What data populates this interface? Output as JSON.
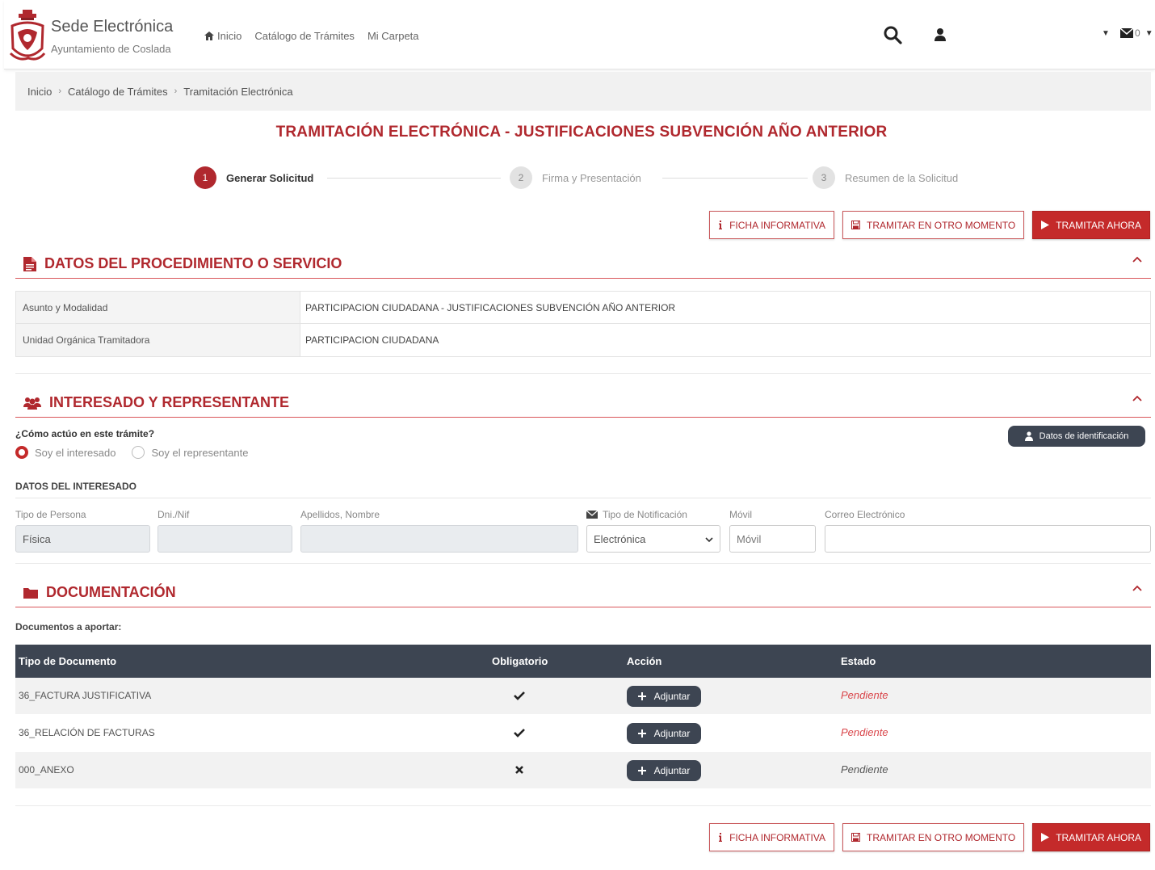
{
  "header": {
    "brand_title": "Sede Electrónica",
    "brand_subtitle": "Ayuntamiento de Coslada",
    "nav": [
      "Inicio",
      "Catálogo de Trámites",
      "Mi Carpeta"
    ],
    "mail_count": "0"
  },
  "breadcrumb": [
    "Inicio",
    "Catálogo de Trámites",
    "Tramitación Electrónica"
  ],
  "page_title": "TRAMITACIÓN ELECTRÓNICA - JUSTIFICACIONES SUBVENCIÓN AÑO ANTERIOR",
  "steps": [
    {
      "num": "1",
      "label": "Generar Solicitud"
    },
    {
      "num": "2",
      "label": "Firma y Presentación"
    },
    {
      "num": "3",
      "label": "Resumen de la Solicitud"
    }
  ],
  "actions": {
    "ficha": "FICHA INFORMATIVA",
    "otro_momento": "TRAMITAR EN OTRO MOMENTO",
    "ahora": "TRAMITAR AHORA"
  },
  "section_datos": {
    "title": "DATOS DEL PROCEDIMIENTO O SERVICIO",
    "rows": [
      {
        "key": "Asunto y Modalidad",
        "value": "PARTICIPACION CIUDADANA - JUSTIFICACIONES SUBVENCIÓN AÑO ANTERIOR"
      },
      {
        "key": "Unidad Orgánica Tramitadora",
        "value": "PARTICIPACION CIUDADANA"
      }
    ]
  },
  "section_interesado": {
    "title": "INTERESADO Y REPRESENTANTE",
    "question": "¿Cómo actúo en este trámite?",
    "radio_interesado": "Soy el interesado",
    "radio_representante": "Soy el representante",
    "ident_button": "Datos de identificación",
    "subheading": "DATOS DEL INTERESADO",
    "labels": {
      "tipo_persona": "Tipo de Persona",
      "dni": "Dni./Nif",
      "apellidos": "Apellidos, Nombre",
      "tipo_notif": "Tipo de Notificación",
      "movil": "Móvil",
      "correo": "Correo Electrónico"
    },
    "values": {
      "tipo_persona": "Física",
      "dni": "",
      "apellidos": "",
      "tipo_notif": "Electrónica",
      "correo": ""
    },
    "placeholders": {
      "movil": "Móvil"
    }
  },
  "section_docs": {
    "title": "DOCUMENTACIÓN",
    "subheading": "Documentos a aportar:",
    "columns": [
      "Tipo de Documento",
      "Obligatorio",
      "Acción",
      "Estado"
    ],
    "adjuntar": "Adjuntar",
    "rows": [
      {
        "tipo": "36_FACTURA JUSTIFICATIVA",
        "obligatorio": "check",
        "estado": "Pendiente"
      },
      {
        "tipo": "36_RELACIÓN DE FACTURAS",
        "obligatorio": "check",
        "estado": "Pendiente"
      },
      {
        "tipo": "000_ANEXO",
        "obligatorio": "cross",
        "estado": "Pendiente"
      }
    ]
  },
  "colors": {
    "accent": "#b0282e",
    "button_red": "#c42a2a",
    "dark": "#3d4552",
    "pending_red": "#d9454a"
  }
}
